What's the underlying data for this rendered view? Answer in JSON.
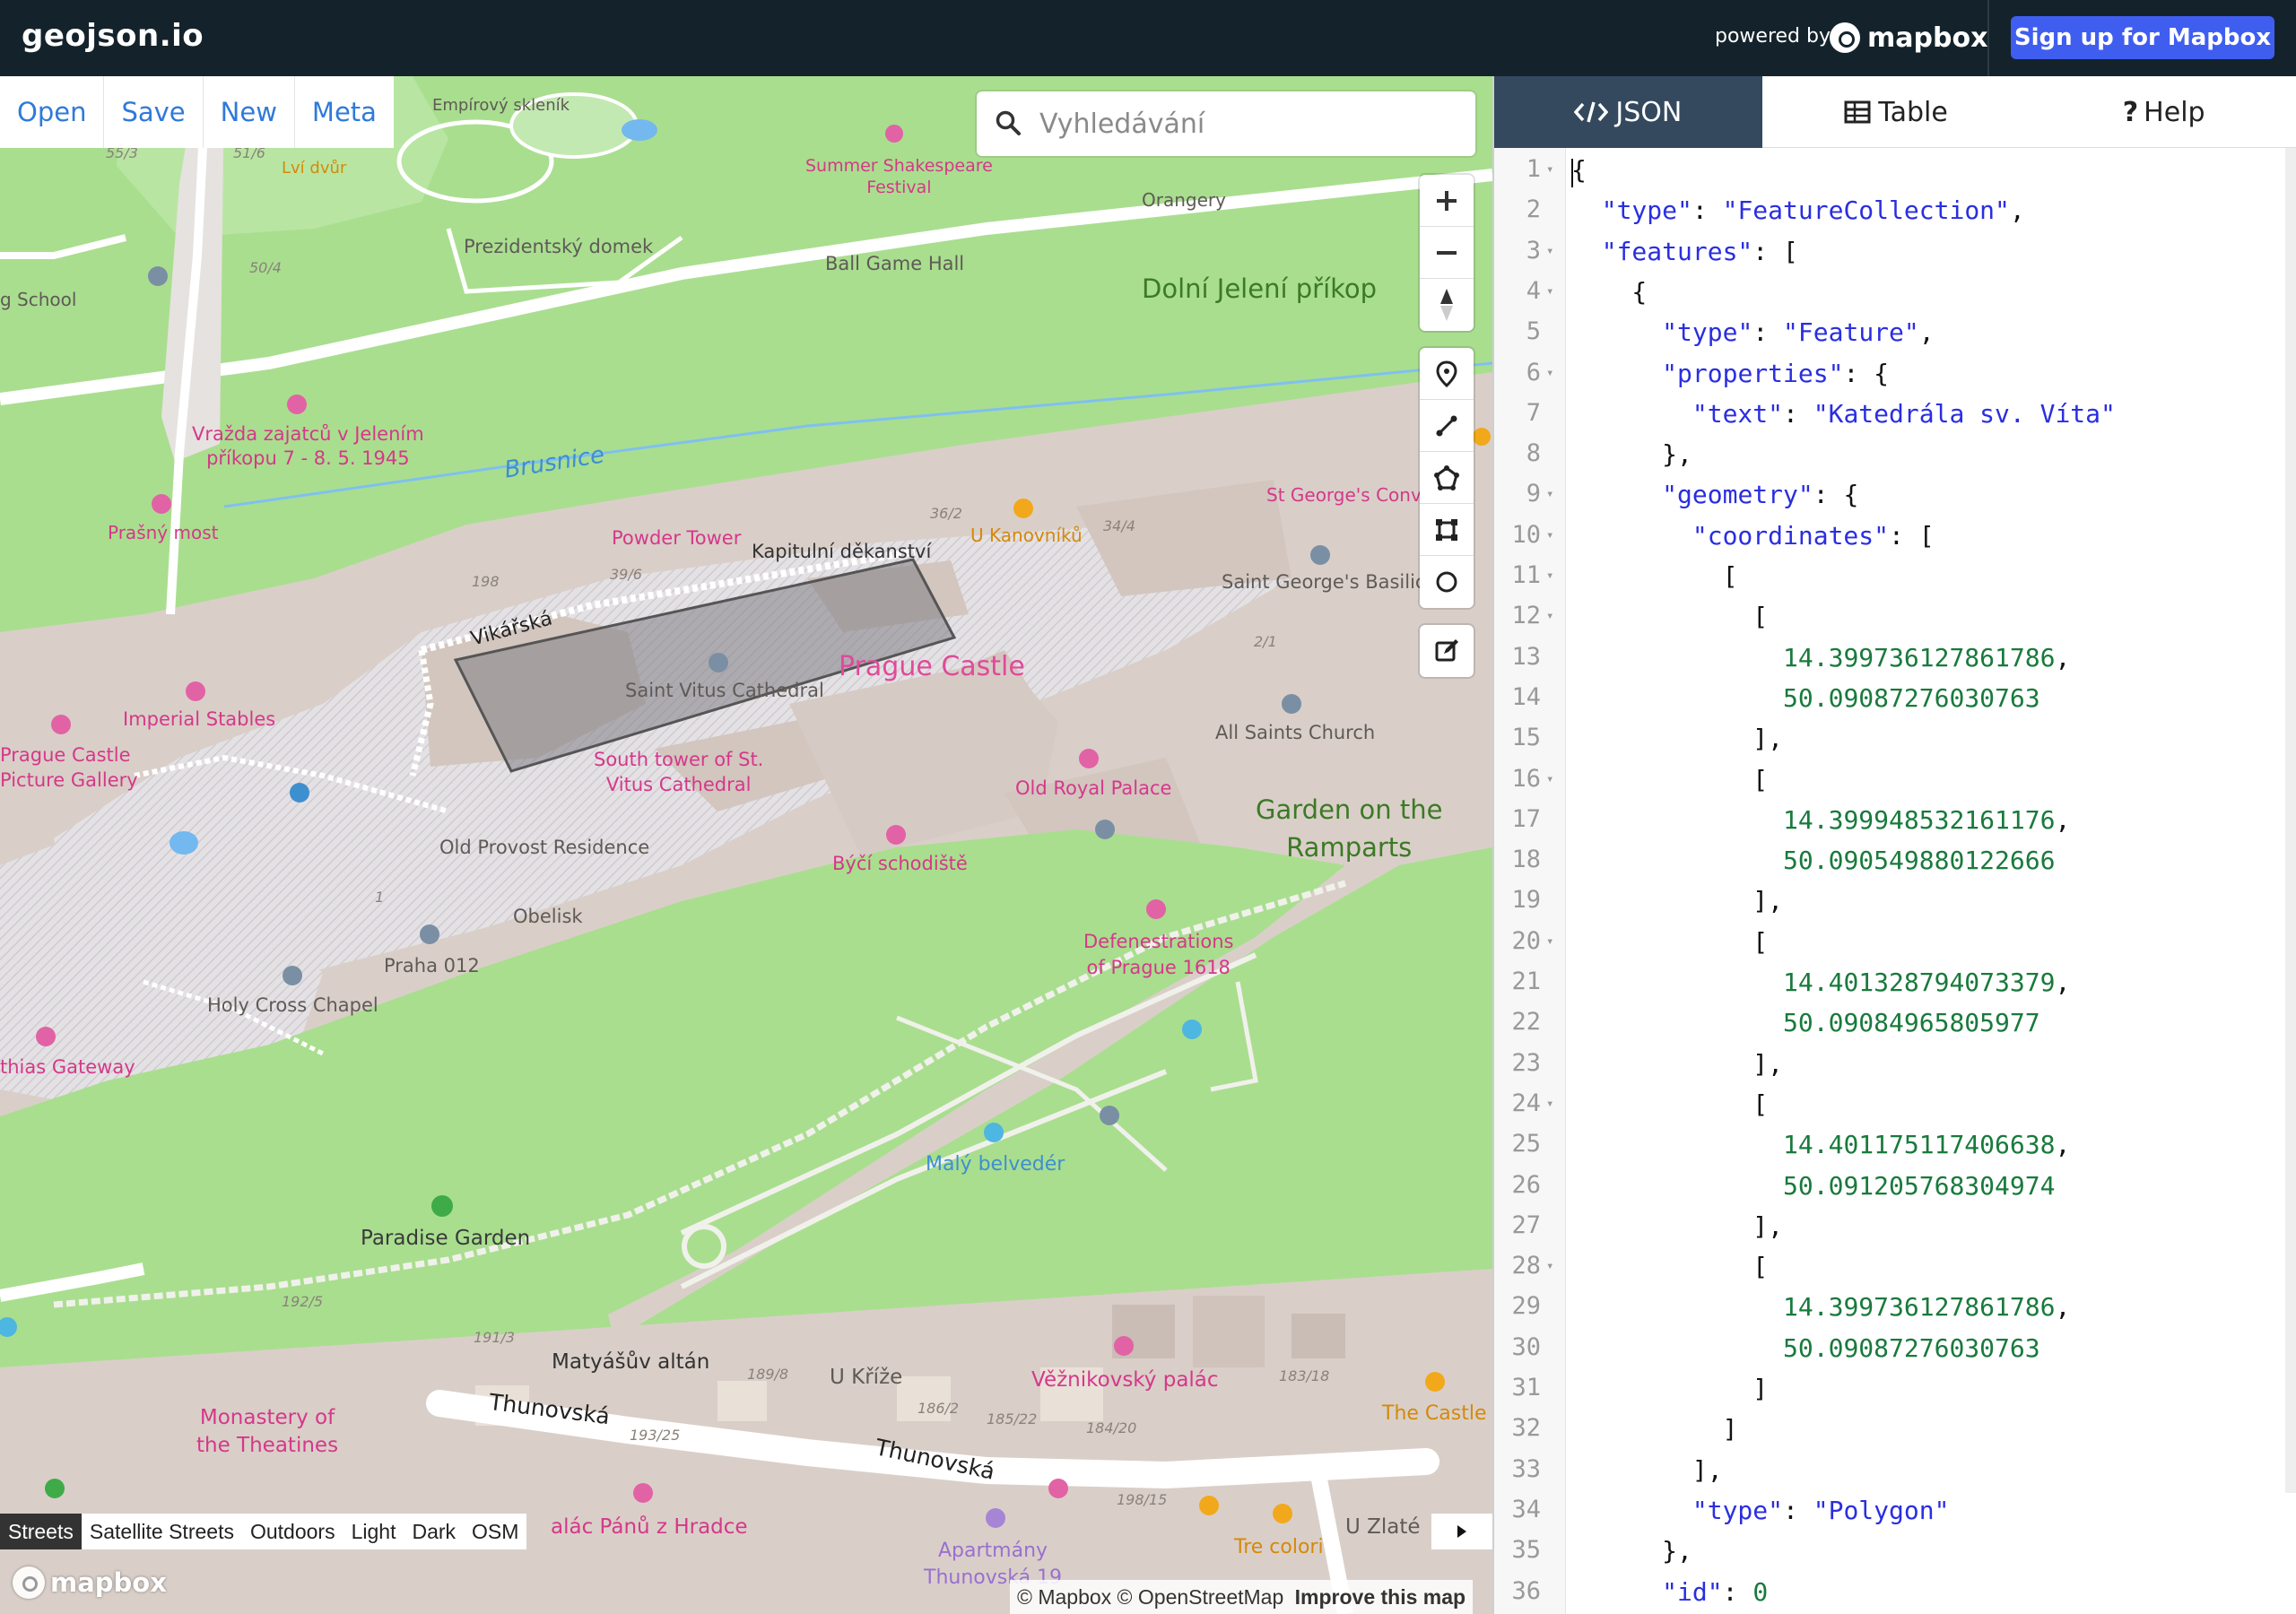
{
  "app": {
    "logo": "geojson.io",
    "powered_by": "powered by",
    "mapbox_brand": "mapbox",
    "signup_label": "Sign up for Mapbox"
  },
  "file_menu": [
    {
      "label": "Open"
    },
    {
      "label": "Save"
    },
    {
      "label": "New"
    },
    {
      "label": "Meta"
    }
  ],
  "search": {
    "placeholder": "Vyhledávání"
  },
  "map_labels": {
    "empirovy": "Empírový skleník",
    "lvi": "Lví dvůr",
    "shakespeare": "Summer Shakespeare\nFestival",
    "orangery": "Orangery",
    "prezidentsky": "Prezidentský domek",
    "ballgame": "Ball Game Hall",
    "jeleni": "Dolní Jelení příkop",
    "school": "g School",
    "vrazda": "Vražda zajatců v Jelením\npříkopu 7 - 8. 5. 1945",
    "brusnice": "Brusnice",
    "stgeorge_conv": "St George's Conve",
    "prasny": "Prašný most",
    "powder": "Powder Tower",
    "kapitulni": "Kapitulní děkanství",
    "kanovniku": "U Kanovníků",
    "stgeorge_bas": "Saint George's Basilica",
    "vikarska": "Vikářská",
    "vitus": "Saint Vitus Cathedral",
    "castle": "Prague Castle",
    "imperial": "Imperial Stables",
    "gallery": "Prague Castle\nPicture Gallery",
    "south_tower": "South tower of St.\nVitus Cathedral",
    "allsaints": "All Saints Church",
    "royal_palace": "Old Royal Palace",
    "garden_ramparts": "Garden on the\nRamparts",
    "provost": "Old Provost Residence",
    "byci": "Býčí schodiště",
    "obelisk": "Obelisk",
    "defenestration": "Defenestrations\nof Prague 1618",
    "praha012": "Praha 012",
    "holycross": "Holy Cross Chapel",
    "gateway": "thias Gateway",
    "maly": "Malý belvedér",
    "paradise": "Paradise Garden",
    "matyasuv": "Matyášův altán",
    "ukrize": "U Kříže",
    "veznikovsky": "Věžnikovský palác",
    "thecastle": "The Castle",
    "monastery": "Monastery of\nthe Theatines",
    "thunovska1": "Thunovská",
    "thunovska2": "Thunovská",
    "palac": "alác Pánů z Hradce",
    "apartmany": "Apartmány\nThunovská 19",
    "trecolori": "Tre colori",
    "uzlate": "U Zlaté",
    "n553": "55/3",
    "n516": "51/6",
    "n504": "50/4",
    "n362": "36/2",
    "n344": "34/4",
    "n396": "39/6",
    "n198": "198",
    "n21": "2/1",
    "n1": "1",
    "n1925": "192/5",
    "n1913": "191/3",
    "n1898": "189/8",
    "n1862": "186/2",
    "n18522": "185/22",
    "n18420": "184/20",
    "n18318": "183/18",
    "n19325": "193/25",
    "n19815": "198/15"
  },
  "map_styles": [
    {
      "label": "Streets",
      "active": true
    },
    {
      "label": "Satellite Streets",
      "active": false
    },
    {
      "label": "Outdoors",
      "active": false
    },
    {
      "label": "Light",
      "active": false
    },
    {
      "label": "Dark",
      "active": false
    },
    {
      "label": "OSM",
      "active": false
    }
  ],
  "map_logo": "mapbox",
  "attribution": {
    "text": "© Mapbox © OpenStreetMap",
    "improve": "Improve this map"
  },
  "tabs": [
    {
      "label": "JSON",
      "icon": "code-icon",
      "active": true
    },
    {
      "label": "Table",
      "icon": "table-icon",
      "active": false
    },
    {
      "label": "Help",
      "icon": "question-icon",
      "active": false
    }
  ],
  "editor": {
    "lines": [
      {
        "n": "1",
        "fold": true,
        "text": "{"
      },
      {
        "n": "2",
        "fold": false,
        "text": "  \"type\": \"FeatureCollection\","
      },
      {
        "n": "3",
        "fold": true,
        "text": "  \"features\": ["
      },
      {
        "n": "4",
        "fold": true,
        "text": "    {"
      },
      {
        "n": "5",
        "fold": false,
        "text": "      \"type\": \"Feature\","
      },
      {
        "n": "6",
        "fold": true,
        "text": "      \"properties\": {"
      },
      {
        "n": "7",
        "fold": false,
        "text": "        \"text\": \"Katedrála sv. Víta\""
      },
      {
        "n": "8",
        "fold": false,
        "text": "      },"
      },
      {
        "n": "9",
        "fold": true,
        "text": "      \"geometry\": {"
      },
      {
        "n": "10",
        "fold": true,
        "text": "        \"coordinates\": ["
      },
      {
        "n": "11",
        "fold": true,
        "text": "          ["
      },
      {
        "n": "12",
        "fold": true,
        "text": "            ["
      },
      {
        "n": "13",
        "fold": false,
        "text": "              14.399736127861786,"
      },
      {
        "n": "14",
        "fold": false,
        "text": "              50.09087276030763"
      },
      {
        "n": "15",
        "fold": false,
        "text": "            ],"
      },
      {
        "n": "16",
        "fold": true,
        "text": "            ["
      },
      {
        "n": "17",
        "fold": false,
        "text": "              14.399948532161176,"
      },
      {
        "n": "18",
        "fold": false,
        "text": "              50.090549880122666"
      },
      {
        "n": "19",
        "fold": false,
        "text": "            ],"
      },
      {
        "n": "20",
        "fold": true,
        "text": "            ["
      },
      {
        "n": "21",
        "fold": false,
        "text": "              14.401328794073379,"
      },
      {
        "n": "22",
        "fold": false,
        "text": "              50.09084965805977"
      },
      {
        "n": "23",
        "fold": false,
        "text": "            ],"
      },
      {
        "n": "24",
        "fold": true,
        "text": "            ["
      },
      {
        "n": "25",
        "fold": false,
        "text": "              14.401175117406638,"
      },
      {
        "n": "26",
        "fold": false,
        "text": "              50.091205768304974"
      },
      {
        "n": "27",
        "fold": false,
        "text": "            ],"
      },
      {
        "n": "28",
        "fold": true,
        "text": "            ["
      },
      {
        "n": "29",
        "fold": false,
        "text": "              14.399736127861786,"
      },
      {
        "n": "30",
        "fold": false,
        "text": "              50.09087276030763"
      },
      {
        "n": "31",
        "fold": false,
        "text": "            ]"
      },
      {
        "n": "32",
        "fold": false,
        "text": "          ]"
      },
      {
        "n": "33",
        "fold": false,
        "text": "        ],"
      },
      {
        "n": "34",
        "fold": false,
        "text": "        \"type\": \"Polygon\""
      },
      {
        "n": "35",
        "fold": false,
        "text": "      },"
      },
      {
        "n": "36",
        "fold": false,
        "text": "      \"id\": 0"
      }
    ]
  },
  "colors": {
    "topbar": "#14232b",
    "signup": "#3f5ef0",
    "link": "#2f7ad9",
    "active_tab": "#34495e",
    "park": "#a7e08e",
    "land": "#d9cfc8",
    "polygon": "#7f7f85"
  }
}
